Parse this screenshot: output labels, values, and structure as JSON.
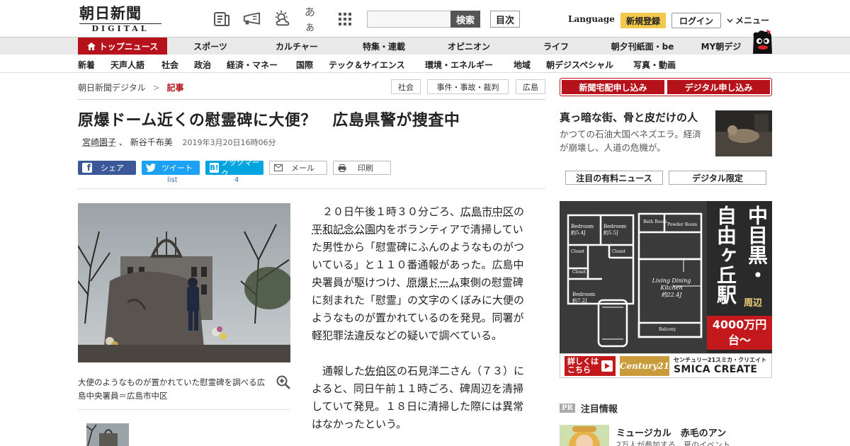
{
  "header": {
    "logo_main": "朝日新聞",
    "logo_sub": "DIGITAL",
    "icons": [
      "newspaper-icon",
      "megaphone-icon",
      "weather-icon",
      "font-size-icon",
      "grid-icon"
    ],
    "font_size_label": "あぁ",
    "search_placeholder": "",
    "search_label": "検索",
    "toc_label": "目次",
    "language_label": "Language",
    "register_label": "新規登録",
    "login_label": "ログイン",
    "menu_label": "メニュー"
  },
  "nav_primary": {
    "top_label": "トップニュース",
    "items": [
      "スポーツ",
      "カルチャー",
      "特集・連載",
      "オピニオン",
      "ライフ",
      "朝夕刊紙面・be",
      "MY朝デジ"
    ]
  },
  "nav_secondary": {
    "items": [
      "新着",
      "天声人語",
      "社会",
      "政治",
      "経済・マネー",
      "国際",
      "テック＆サイエンス",
      "環境・エネルギー",
      "地域",
      "朝デジスペシャル",
      "写真・動画"
    ]
  },
  "breadcrumb": {
    "home": "朝日新聞デジタル",
    "sep": ">",
    "current": "記事"
  },
  "tags": [
    "社会",
    "事件・事故・裁判",
    "広島"
  ],
  "article": {
    "title": "原爆ドーム近くの慰霊碑に大便？　広島県警が捜査中",
    "author1": "宮崎園子",
    "author_sep": "、",
    "author2": "新谷千布美",
    "date": "2019年3月20日16時06分",
    "share": {
      "facebook": "シェア",
      "twitter": "ツイート",
      "twitter_count": "list",
      "hatena": "ブックマーク",
      "hatena_count": "4",
      "mail": "メール",
      "print": "印刷"
    },
    "photo_caption": "大便のようなものが置かれていた慰霊碑を調べる広島中央署員＝広島市中区",
    "p1_a": "２０日午後１時３０分ごろ、",
    "p1_link1": "広島市中区",
    "p1_b": "の",
    "p1_link2": "平和記念公園",
    "p1_c": "内をボランティアで清掃していた男性から「慰霊碑にふんのようなものがついている」と１１０番通報があった。広島中央署員が駆けつけ、",
    "p1_link3": "原爆ドーム",
    "p1_d": "東側の慰霊碑に刻まれた「慰霊」の文字のくぼみに大便のようなものが置かれているのを発見。同署が軽犯罪法違反などの疑いで調べている。",
    "p2_a": "通報した",
    "p2_link1": "佐伯区",
    "p2_b": "の石見洋二さん（７３）によると、同日午前１１時ごろ、碑周辺を清掃していて発見。１８日に清掃した際には異常はなかったという。"
  },
  "sidebar": {
    "btn_delivery": "新聞宅配申し込み",
    "btn_digital": "デジタル申し込み",
    "feature_title": "真っ暗な街、骨と皮だけの人",
    "feature_text": "かつての石油大国ベネズエラ。経済が崩壊し、人道の危機が。",
    "tab_paid": "注目の有料ニュース",
    "tab_digital": "デジタル限定",
    "ad": {
      "area1": "中目黒・",
      "area1_sub": "周辺",
      "area2": "自由ヶ丘駅",
      "price": "4000万円台～",
      "detail_btn": "詳しくはこちら",
      "brand_logo": "Century21",
      "company_small": "センチュリー21スミカ・クリエイト",
      "company": "SMICA CREATE",
      "rooms": [
        "Bedroom",
        "Bedroom",
        "Closet",
        "Closet",
        "Closet",
        "Bedroom",
        "Bath Room",
        "Powder Room",
        "Living Dining Kitchen",
        "Balcony"
      ],
      "room_sizes": [
        "約5.4J",
        "約5.5J",
        "約7.2J",
        "約22.4J"
      ]
    },
    "pr_badge": "PR",
    "pr_label": "注目情報",
    "pr_item_title": "ミュージカル　赤毛のアン",
    "pr_item_sub": "2万人が参加する、夏のイベント"
  },
  "colors": {
    "brand_red": "#b5121b",
    "register_yellow": "#f2c94c",
    "facebook": "#3b5998",
    "twitter": "#1da1f2",
    "hatena": "#00a4de",
    "ad_dark": "#3a3a3a",
    "ad_red": "#c4191c"
  }
}
